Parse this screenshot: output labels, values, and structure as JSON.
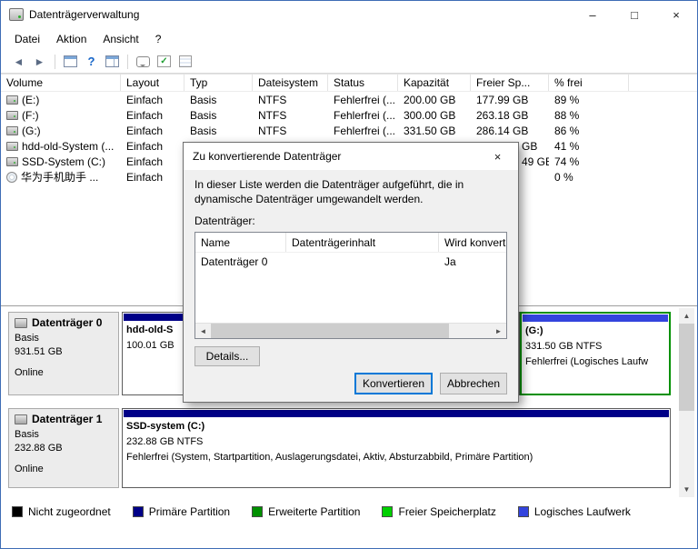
{
  "window": {
    "title": "Datenträgerverwaltung",
    "controls": {
      "minimize": "–",
      "maximize": "□",
      "close": "×"
    }
  },
  "menu": {
    "items": [
      "Datei",
      "Aktion",
      "Ansicht",
      "?"
    ]
  },
  "toolbar": {
    "back_glyph": "◄",
    "forward_glyph": "►",
    "help_glyph": "?",
    "check_glyph": "✓"
  },
  "volume_list": {
    "columns": [
      "Volume",
      "Layout",
      "Typ",
      "Dateisystem",
      "Status",
      "Kapazität",
      "Freier Sp...",
      "% frei"
    ],
    "rows": [
      {
        "volume": "(E:)",
        "layout": "Einfach",
        "typ": "Basis",
        "fs": "NTFS",
        "status": "Fehlerfrei (...",
        "cap": "200.00 GB",
        "free": "177.99 GB",
        "pct": "89 %"
      },
      {
        "volume": "(F:)",
        "layout": "Einfach",
        "typ": "Basis",
        "fs": "NTFS",
        "status": "Fehlerfrei (...",
        "cap": "300.00 GB",
        "free": "263.18 GB",
        "pct": "88 %"
      },
      {
        "volume": "(G:)",
        "layout": "Einfach",
        "typ": "Basis",
        "fs": "NTFS",
        "status": "Fehlerfrei (...",
        "cap": "331.50 GB",
        "free": "286.14 GB",
        "pct": "86 %"
      },
      {
        "volume": "hdd-old-System (...",
        "layout": "Einfach",
        "free": "GB",
        "pct": "41 %"
      },
      {
        "volume": "SSD-System (C:)",
        "layout": "Einfach",
        "free": "49 GB",
        "pct": "74 %"
      },
      {
        "volume": "华为手机助手 ...",
        "layout": "Einfach",
        "pct": "0 %"
      }
    ]
  },
  "dialog": {
    "title": "Zu konvertierende Datenträger",
    "close_glyph": "×",
    "message": "In dieser Liste werden die Datenträger aufgeführt, die in dynamische Datenträger umgewandelt werden.",
    "list_label": "Datenträger:",
    "columns": [
      "Name",
      "Datenträgerinhalt",
      "Wird konvertie"
    ],
    "rows": [
      {
        "name": "Datenträger 0",
        "content": "",
        "converted": "Ja"
      }
    ],
    "details_button": "Details...",
    "convert_button": "Konvertieren",
    "cancel_button": "Abbrechen",
    "scroll_left": "◄",
    "scroll_right": "►"
  },
  "disks": [
    {
      "label": "Datenträger 0",
      "type": "Basis",
      "size": "931.51 GB",
      "status": "Online",
      "partitions": [
        {
          "name": "hdd-old-S",
          "line2": "100.01 GB",
          "line3": ""
        },
        {
          "name": "(G:)",
          "line2": "331.50 GB NTFS",
          "line3": "Fehlerfrei (Logisches Laufw"
        }
      ]
    },
    {
      "label": "Datenträger 1",
      "type": "Basis",
      "size": "232.88 GB",
      "status": "Online",
      "partitions": [
        {
          "name": "SSD-system  (C:)",
          "line2": "232.88 GB NTFS",
          "line3": "Fehlerfrei (System, Startpartition, Auslagerungsdatei, Aktiv, Absturzabbild, Primäre Partition)"
        }
      ]
    }
  ],
  "scrollbar": {
    "up": "▲",
    "down": "▼"
  },
  "legend": {
    "items": [
      {
        "label": "Nicht zugeordnet",
        "color": "#000000"
      },
      {
        "label": "Primäre Partition",
        "color": "#000088"
      },
      {
        "label": "Erweiterte Partition",
        "color": "#009000"
      },
      {
        "label": "Freier Speicherplatz",
        "color": "#00d000"
      },
      {
        "label": "Logisches Laufwerk",
        "color": "#3344dd"
      }
    ]
  }
}
